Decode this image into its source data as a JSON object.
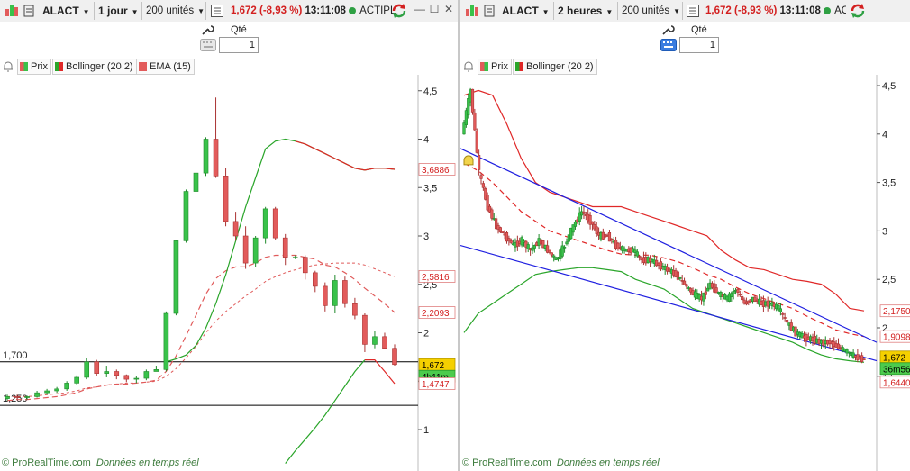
{
  "colors": {
    "up": "#39c24a",
    "down": "#e25b5b",
    "bollinger_mid": "#2aa52a",
    "bollinger_band": "#e02828",
    "ema": "#e05a5a",
    "trendline": "#1f1fe0",
    "hline": "#000000",
    "price_tag": "#f5d000",
    "timer_tag": "#4dcb4d"
  },
  "left": {
    "toolbar": {
      "symbol": "ALACT",
      "timeframe": "1 jour",
      "units": "200 unités",
      "price": "1,672",
      "change": "(-8,93 %)",
      "time": "13:11:08",
      "market": "ACTIPL"
    },
    "order": {
      "qty_label": "Qté",
      "qty_value": "1"
    },
    "legend": {
      "prix": "Prix",
      "bollinger": "Bollinger (20 2)",
      "ema": "EMA (15)"
    },
    "axis": {
      "ticks": [
        "4,5",
        "4",
        "3,5",
        "3",
        "2,5",
        "2",
        "1,5",
        "1"
      ]
    },
    "hlines": [
      {
        "label": "1,700",
        "value": 1.7
      },
      {
        "label": "1,250",
        "value": 1.25
      }
    ],
    "tags": {
      "upper": "3,6886",
      "ma": "2,5816",
      "ema": "2,2093",
      "price": "1,672",
      "timer": "4h11m",
      "lower": "1,4747"
    },
    "footer": {
      "brand": "© ProRealTime.com",
      "note": "Données en temps réel"
    }
  },
  "right": {
    "toolbar": {
      "symbol": "ALACT",
      "timeframe": "2 heures",
      "units": "200 unités",
      "price": "1,672",
      "change": "(-8,93 %)",
      "time": "13:11:08",
      "market": "ACT"
    },
    "order": {
      "qty_label": "Qté",
      "qty_value": "1"
    },
    "legend": {
      "prix": "Prix",
      "bollinger": "Bollinger (20 2)"
    },
    "axis": {
      "ticks": [
        "4,5",
        "4",
        "3,5",
        "3",
        "2,5",
        "2",
        "1,5"
      ]
    },
    "tags": {
      "upper": "2,1750",
      "mid": "1,9098",
      "price": "1,672",
      "timer": "36m56",
      "lower": "1,6440"
    },
    "footer": {
      "brand": "© ProRealTime.com",
      "note": "Données en temps réel"
    }
  },
  "chart_data": [
    {
      "type": "candlestick",
      "title": "",
      "ylim": [
        0.6,
        4.8
      ],
      "candles": [
        [
          1.32,
          1.36,
          1.3,
          1.34
        ],
        [
          1.34,
          1.36,
          1.31,
          1.33
        ],
        [
          1.33,
          1.35,
          1.31,
          1.34
        ],
        [
          1.34,
          1.4,
          1.33,
          1.38
        ],
        [
          1.38,
          1.42,
          1.36,
          1.4
        ],
        [
          1.4,
          1.44,
          1.38,
          1.42
        ],
        [
          1.42,
          1.5,
          1.4,
          1.48
        ],
        [
          1.48,
          1.56,
          1.46,
          1.54
        ],
        [
          1.54,
          1.74,
          1.52,
          1.7
        ],
        [
          1.7,
          1.72,
          1.55,
          1.58
        ],
        [
          1.58,
          1.66,
          1.54,
          1.6
        ],
        [
          1.6,
          1.62,
          1.52,
          1.56
        ],
        [
          1.56,
          1.57,
          1.49,
          1.52
        ],
        [
          1.52,
          1.55,
          1.48,
          1.53
        ],
        [
          1.53,
          1.62,
          1.51,
          1.6
        ],
        [
          1.6,
          1.66,
          1.6,
          1.62
        ],
        [
          1.62,
          2.22,
          1.6,
          2.2
        ],
        [
          2.2,
          2.96,
          2.18,
          2.95
        ],
        [
          2.95,
          3.48,
          2.93,
          3.46
        ],
        [
          3.46,
          3.68,
          3.4,
          3.65
        ],
        [
          3.65,
          4.02,
          3.62,
          4.0
        ],
        [
          4.0,
          4.43,
          3.6,
          3.62
        ],
        [
          3.62,
          3.7,
          3.1,
          3.15
        ],
        [
          3.15,
          3.25,
          2.95,
          3.0
        ],
        [
          3.0,
          3.1,
          2.66,
          2.72
        ],
        [
          2.72,
          3.0,
          2.68,
          2.98
        ],
        [
          2.98,
          3.3,
          2.92,
          3.28
        ],
        [
          3.28,
          3.3,
          2.96,
          2.98
        ],
        [
          2.98,
          3.02,
          2.7,
          2.78
        ],
        [
          2.78,
          2.8,
          2.76,
          2.78
        ],
        [
          2.78,
          2.8,
          2.55,
          2.62
        ],
        [
          2.62,
          2.64,
          2.42,
          2.48
        ],
        [
          2.48,
          2.52,
          2.22,
          2.28
        ],
        [
          2.28,
          2.6,
          2.2,
          2.54
        ],
        [
          2.54,
          2.58,
          2.26,
          2.3
        ],
        [
          2.3,
          2.36,
          2.14,
          2.18
        ],
        [
          2.18,
          2.2,
          1.8,
          1.88
        ],
        [
          1.88,
          2.02,
          1.84,
          1.96
        ],
        [
          1.96,
          2.0,
          1.84,
          1.84
        ],
        [
          1.84,
          1.88,
          1.66,
          1.672
        ]
      ],
      "bollinger_upper": [
        null,
        null,
        null,
        null,
        null,
        null,
        null,
        null,
        null,
        null,
        null,
        null,
        null,
        null,
        null,
        null,
        1.7,
        1.73,
        1.77,
        1.87,
        2.05,
        2.3,
        2.6,
        2.95,
        3.3,
        3.6,
        3.9,
        3.98,
        4.0,
        3.98,
        3.95,
        3.9,
        3.85,
        3.8,
        3.75,
        3.7,
        3.68,
        3.7,
        3.7,
        3.6886
      ],
      "bollinger_mid": [
        1.34,
        1.34,
        1.34,
        1.35,
        1.36,
        1.37,
        1.38,
        1.4,
        1.43,
        1.44,
        1.46,
        1.47,
        1.48,
        1.48,
        1.49,
        1.5,
        1.55,
        1.63,
        1.74,
        1.86,
        2.0,
        2.12,
        2.22,
        2.3,
        2.38,
        2.45,
        2.53,
        2.58,
        2.62,
        2.65,
        2.68,
        2.7,
        2.71,
        2.72,
        2.72,
        2.72,
        2.7,
        2.66,
        2.62,
        2.5816
      ],
      "bollinger_lower": [
        null,
        null,
        null,
        null,
        null,
        null,
        null,
        null,
        null,
        null,
        null,
        null,
        null,
        null,
        null,
        null,
        null,
        null,
        null,
        null,
        null,
        null,
        null,
        null,
        null,
        null,
        null,
        null,
        0.65,
        0.78,
        0.9,
        1.02,
        1.15,
        1.3,
        1.45,
        1.6,
        1.72,
        1.72,
        1.6,
        1.4747
      ],
      "ema": [
        1.3,
        1.31,
        1.31,
        1.32,
        1.33,
        1.34,
        1.36,
        1.38,
        1.42,
        1.44,
        1.46,
        1.47,
        1.47,
        1.48,
        1.49,
        1.51,
        1.6,
        1.76,
        1.97,
        2.18,
        2.4,
        2.56,
        2.64,
        2.68,
        2.68,
        2.72,
        2.78,
        2.8,
        2.8,
        2.8,
        2.78,
        2.76,
        2.7,
        2.68,
        2.62,
        2.55,
        2.46,
        2.38,
        2.3,
        2.2093
      ]
    },
    {
      "type": "candlestick",
      "title": "",
      "ylim": [
        1.35,
        4.78
      ],
      "candles_from_points": [
        4.0,
        4.45,
        3.6,
        3.25,
        3.05,
        2.95,
        2.85,
        2.9,
        2.8,
        2.9,
        2.8,
        2.7,
        2.85,
        3.05,
        3.2,
        3.1,
        2.95,
        2.95,
        2.85,
        2.8,
        2.8,
        2.7,
        2.7,
        2.65,
        2.6,
        2.55,
        2.45,
        2.35,
        2.3,
        2.45,
        2.35,
        2.3,
        2.4,
        2.25,
        2.3,
        2.25,
        2.25,
        2.2,
        2.05,
        1.95,
        1.9,
        1.88,
        1.85,
        1.85,
        1.8,
        1.75,
        1.7,
        1.672
      ],
      "bollinger_upper": [
        4.4,
        4.45,
        4.4,
        4.1,
        3.75,
        3.5,
        3.4,
        3.35,
        3.3,
        3.25,
        3.25,
        3.25,
        3.2,
        3.15,
        3.1,
        3.05,
        3.0,
        2.95,
        2.8,
        2.7,
        2.62,
        2.6,
        2.55,
        2.5,
        2.48,
        2.45,
        2.35,
        2.2,
        2.175
      ],
      "bollinger_mid": [
        3.7,
        3.62,
        3.5,
        3.35,
        3.2,
        3.1,
        3.0,
        2.95,
        2.9,
        2.85,
        2.8,
        2.76,
        2.75,
        2.75,
        2.72,
        2.68,
        2.62,
        2.55,
        2.5,
        2.42,
        2.35,
        2.3,
        2.25,
        2.2,
        2.12,
        2.05,
        1.98,
        1.94,
        1.9098
      ],
      "bollinger_lower": [
        1.95,
        2.15,
        2.25,
        2.35,
        2.45,
        2.55,
        2.58,
        2.6,
        2.62,
        2.62,
        2.6,
        2.58,
        2.5,
        2.45,
        2.4,
        2.3,
        2.2,
        2.15,
        2.1,
        2.05,
        2.0,
        1.95,
        1.9,
        1.85,
        1.78,
        1.72,
        1.68,
        1.66,
        1.644
      ],
      "trendlines": [
        {
          "from": [
            0,
            3.85
          ],
          "to": [
            1,
            1.85
          ]
        },
        {
          "from": [
            0,
            2.85
          ],
          "to": [
            1,
            1.66
          ]
        }
      ]
    }
  ]
}
